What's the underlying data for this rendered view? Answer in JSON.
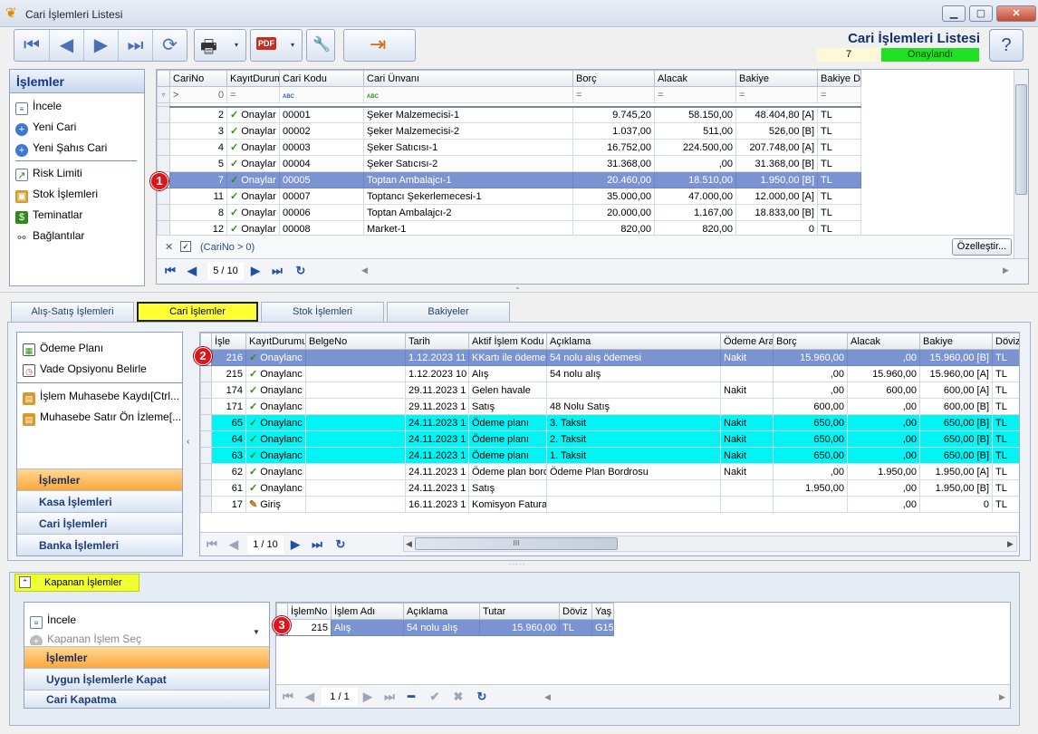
{
  "window": {
    "title": "Cari İşlemleri Listesi",
    "minimize": "▁",
    "maximize": "▢",
    "close": "✕"
  },
  "header": {
    "title": "Cari İşlemleri Listesi",
    "count": "7",
    "status": "Onaylandı",
    "help": "?"
  },
  "toolbar": {
    "first": "⏮",
    "prev": "◀",
    "next": "▶",
    "last": "⏭",
    "refresh": "⟳",
    "print": "🖶",
    "pdf": "PDF",
    "tools": "🔧",
    "exit": "⇥",
    "dd": "▾"
  },
  "actions_top": {
    "title": "İşlemler",
    "items": [
      {
        "label": "İncele",
        "icon": "document-icon"
      },
      {
        "label": "Yeni Cari",
        "icon": "plus-circle-icon"
      },
      {
        "label": "Yeni Şahıs Cari",
        "icon": "plus-circle-icon"
      },
      {
        "label": "Risk Limiti",
        "icon": "chart-icon"
      },
      {
        "label": "Stok İşlemleri",
        "icon": "box-icon"
      },
      {
        "label": "Teminatlar",
        "icon": "money-icon"
      },
      {
        "label": "Bağlantılar",
        "icon": "link-icon"
      }
    ]
  },
  "cari_grid": {
    "columns": [
      "CariNo",
      "KayıtDurumu",
      "Cari Kodu",
      "Cari Ünvanı",
      "Borç",
      "Alacak",
      "Bakiye",
      "Bakiye D"
    ],
    "filter_cariNo": "0",
    "filter_op": "=",
    "filter_abc": "ABC",
    "rows": [
      {
        "no": "2",
        "durum": "Onaylar",
        "kod": "00001",
        "unvan": "Şeker Malzemecisi-1",
        "borc": "9.745,20",
        "alacak": "58.150,00",
        "bakiye": "48.404,80 [A]",
        "bd": "TL"
      },
      {
        "no": "3",
        "durum": "Onaylar",
        "kod": "00002",
        "unvan": "Şeker Malzemecisi-2",
        "borc": "1.037,00",
        "alacak": "511,00",
        "bakiye": "526,00 [B]",
        "bd": "TL"
      },
      {
        "no": "4",
        "durum": "Onaylar",
        "kod": "00003",
        "unvan": "Şeker Satıcısı-1",
        "borc": "16.752,00",
        "alacak": "224.500,00",
        "bakiye": "207.748,00 [A]",
        "bd": "TL"
      },
      {
        "no": "5",
        "durum": "Onaylar",
        "kod": "00004",
        "unvan": "Şeker Satıcısı-2",
        "borc": "31.368,00",
        "alacak": ",00",
        "bakiye": "31.368,00 [B]",
        "bd": "TL"
      },
      {
        "no": "7",
        "durum": "Onaylar",
        "kod": "00005",
        "unvan": "Toptan Ambalajcı-1",
        "borc": "20.460,00",
        "alacak": "18.510,00",
        "bakiye": "1.950,00 [B]",
        "bd": "TL"
      },
      {
        "no": "11",
        "durum": "Onaylar",
        "kod": "00007",
        "unvan": "Toptancı Şekerlemecesi-1",
        "borc": "35.000,00",
        "alacak": "47.000,00",
        "bakiye": "12.000,00 [A]",
        "bd": "TL"
      },
      {
        "no": "8",
        "durum": "Onaylar",
        "kod": "00006",
        "unvan": "Toptan Ambalajcı-2",
        "borc": "20.000,00",
        "alacak": "1.167,00",
        "bakiye": "18.833,00 [B]",
        "bd": "TL"
      },
      {
        "no": "12",
        "durum": "Onaylar",
        "kod": "00008",
        "unvan": "Market-1",
        "borc": "820,00",
        "alacak": "820,00",
        "bakiye": "0",
        "bd": "TL"
      }
    ],
    "filter_text": "(CariNo > 0)",
    "customize": "Özelleştir...",
    "page": "5 / 10"
  },
  "tabs": [
    "Alış-Satış İşlemleri",
    "Cari İşlemler",
    "Stok İşlemleri",
    "Bakiyeler"
  ],
  "actions_mid": {
    "items": [
      {
        "label": "Ödeme Planı",
        "icon": "calendar-icon"
      },
      {
        "label": "Vade Opsiyonu Belirle",
        "icon": "calendar-clock-icon"
      },
      {
        "label": "İşlem Muhasebe Kaydı[Ctrl...",
        "icon": "ledger-icon"
      },
      {
        "label": "Muhasebe Satır Ön İzleme[...",
        "icon": "ledger-icon"
      }
    ],
    "nav": [
      "İşlemler",
      "Kasa İşlemleri",
      "Cari İşlemleri",
      "Banka İşlemleri"
    ],
    "collapse": "‹"
  },
  "islem_grid": {
    "columns": [
      "İşle",
      "KayıtDurumu",
      "BelgeNo",
      "Tarih",
      "Aktif İşlem Kodu",
      "Açıklama",
      "Ödeme Araç",
      "Borç",
      "Alacak",
      "Bakiye",
      "Döviz"
    ],
    "rows": [
      {
        "no": "216",
        "durum": "Onaylanc",
        "belge": "",
        "tarih": "1.12.2023 11",
        "kod": "KKartı ile ödeme",
        "aciklama": "54 nolu alış ödemesi",
        "arac": "Nakit",
        "borc": "15.960,00",
        "alacak": ",00",
        "bakiye": "15.960,00 [B]",
        "doviz": "TL",
        "style": "sel",
        "icon": "check"
      },
      {
        "no": "215",
        "durum": "Onaylanc",
        "belge": "",
        "tarih": "1.12.2023 10",
        "kod": "Alış",
        "aciklama": "54 nolu alış",
        "arac": "",
        "borc": ",00",
        "alacak": "15.960,00",
        "bakiye": "15.960,00 [A]",
        "doviz": "TL",
        "style": "",
        "icon": "check"
      },
      {
        "no": "174",
        "durum": "Onaylanc",
        "belge": "",
        "tarih": "29.11.2023 1",
        "kod": "Gelen havale",
        "aciklama": "",
        "arac": "Nakit",
        "borc": ",00",
        "alacak": "600,00",
        "bakiye": "600,00 [A]",
        "doviz": "TL",
        "style": "",
        "icon": "check"
      },
      {
        "no": "171",
        "durum": "Onaylanc",
        "belge": "",
        "tarih": "29.11.2023 1",
        "kod": "Satış",
        "aciklama": "48 Nolu Satış",
        "arac": "",
        "borc": "600,00",
        "alacak": ",00",
        "bakiye": "600,00 [B]",
        "doviz": "TL",
        "style": "",
        "icon": "check"
      },
      {
        "no": "65",
        "durum": "Onaylanc",
        "belge": "",
        "tarih": "24.11.2023 1",
        "kod": "Ödeme planı",
        "aciklama": "3. Taksit",
        "arac": "Nakit",
        "borc": "650,00",
        "alacak": ",00",
        "bakiye": "650,00 [B]",
        "doviz": "TL",
        "style": "cyan",
        "icon": "check"
      },
      {
        "no": "64",
        "durum": "Onaylanc",
        "belge": "",
        "tarih": "24.11.2023 1",
        "kod": "Ödeme planı",
        "aciklama": "2. Taksit",
        "arac": "Nakit",
        "borc": "650,00",
        "alacak": ",00",
        "bakiye": "650,00 [B]",
        "doviz": "TL",
        "style": "cyan",
        "icon": "check"
      },
      {
        "no": "63",
        "durum": "Onaylanc",
        "belge": "",
        "tarih": "24.11.2023 1",
        "kod": "Ödeme planı",
        "aciklama": "1. Taksit",
        "arac": "Nakit",
        "borc": "650,00",
        "alacak": ",00",
        "bakiye": "650,00 [B]",
        "doviz": "TL",
        "style": "cyan",
        "icon": "check"
      },
      {
        "no": "62",
        "durum": "Onaylanc",
        "belge": "",
        "tarih": "24.11.2023 1",
        "kod": "Ödeme plan borc",
        "aciklama": "Ödeme Plan Bordrosu",
        "arac": "Nakit",
        "borc": ",00",
        "alacak": "1.950,00",
        "bakiye": "1.950,00 [A]",
        "doviz": "TL",
        "style": "",
        "icon": "check"
      },
      {
        "no": "61",
        "durum": "Onaylanc",
        "belge": "",
        "tarih": "24.11.2023 1",
        "kod": "Satış",
        "aciklama": "",
        "arac": "",
        "borc": "1.950,00",
        "alacak": ",00",
        "bakiye": "1.950,00 [B]",
        "doviz": "TL",
        "style": "",
        "icon": "check"
      },
      {
        "no": "17",
        "durum": "Giriş",
        "belge": "",
        "tarih": "16.11.2023 1",
        "kod": "Komisyon Fatura",
        "aciklama": "",
        "arac": "",
        "borc": "",
        "alacak": ",00",
        "bakiye": "0",
        "doviz": "TL",
        "style": "",
        "icon": "edit"
      }
    ],
    "page": "1 / 10",
    "scroll_grip": "III"
  },
  "closed": {
    "title": "Kapanan İşlemler",
    "toggle": "⌃",
    "actions": [
      {
        "label": "İncele",
        "icon": "document-icon"
      },
      {
        "label": "Kapanan İşlem Seç",
        "icon": "plus-circle-icon"
      }
    ],
    "nav": [
      "İşlemler",
      "Uygun İşlemlerle Kapat",
      "Cari Kapatma"
    ],
    "columns": [
      "İşlemNo",
      "İşlem Adı",
      "Açıklama",
      "Tutar",
      "Döviz",
      "Yaş"
    ],
    "rows": [
      {
        "no": "215",
        "ad": "Alış",
        "aciklama": "54 nolu alış",
        "tutar": "15.960,00",
        "doviz": "TL",
        "yas": "G15"
      }
    ],
    "page": "1 / 1"
  },
  "badges": [
    "1",
    "2",
    "3"
  ]
}
